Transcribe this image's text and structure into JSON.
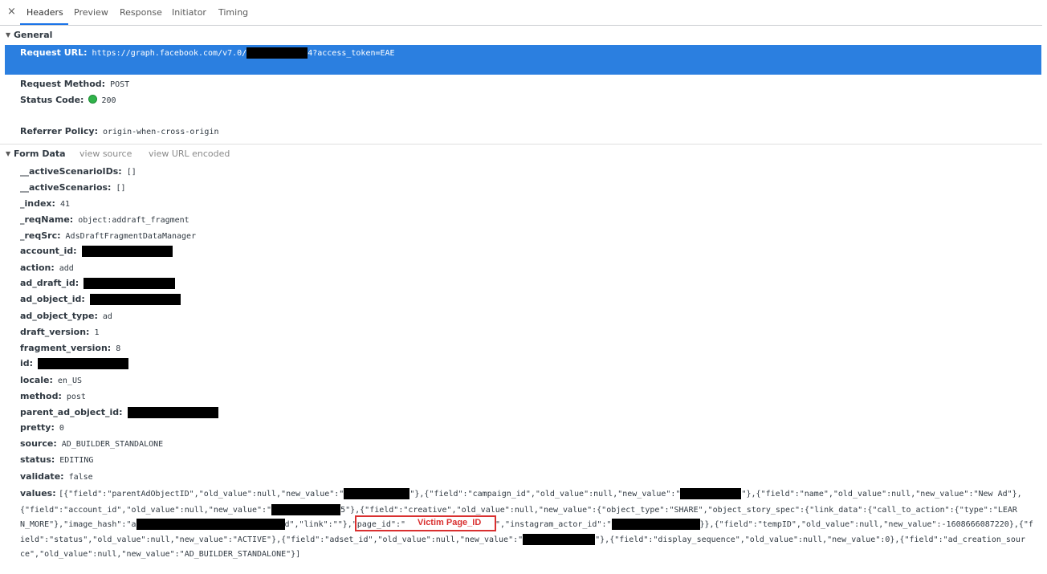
{
  "tabs": {
    "close_glyph": "×",
    "items": [
      "Headers",
      "Preview",
      "Response",
      "Initiator",
      "Timing"
    ],
    "active": "Headers"
  },
  "general": {
    "title": "General",
    "request_url_key": "Request URL:",
    "request_url_prefix": "https://graph.facebook.com/v7.0/",
    "request_url_suffix": "4?access_token=EAE",
    "request_method_key": "Request Method:",
    "request_method": "POST",
    "status_code_key": "Status Code:",
    "status_code": "200",
    "referrer_policy_key": "Referrer Policy:",
    "referrer_policy": "origin-when-cross-origin"
  },
  "form_data": {
    "title": "Form Data",
    "view_source": "view source",
    "view_url_encoded": "view URL encoded",
    "fields": [
      {
        "key": "__activeScenarioIDs:",
        "value": "[]"
      },
      {
        "key": "__activeScenarios:",
        "value": "[]"
      },
      {
        "key": "_index:",
        "value": "41"
      },
      {
        "key": "_reqName:",
        "value": "object:addraft_fragment"
      },
      {
        "key": "_reqSrc:",
        "value": "AdsDraftFragmentDataManager"
      },
      {
        "key": "account_id:",
        "value": ""
      },
      {
        "key": "action:",
        "value": "add"
      },
      {
        "key": "ad_draft_id:",
        "value": ""
      },
      {
        "key": "ad_object_id:",
        "value": ""
      },
      {
        "key": "ad_object_type:",
        "value": "ad"
      },
      {
        "key": "draft_version:",
        "value": "1"
      },
      {
        "key": "fragment_version:",
        "value": "8"
      },
      {
        "key": "id:",
        "value": ""
      },
      {
        "key": "locale:",
        "value": "en_US"
      },
      {
        "key": "method:",
        "value": "post"
      },
      {
        "key": "parent_ad_object_id:",
        "value": ""
      },
      {
        "key": "pretty:",
        "value": "0"
      },
      {
        "key": "source:",
        "value": "AD_BUILDER_STANDALONE"
      },
      {
        "key": "status:",
        "value": "EDITING"
      },
      {
        "key": "validate:",
        "value": "false"
      }
    ],
    "values_key": "values:",
    "values_l1_a": "[{\"field\":\"parentAdObjectID\",\"old_value\":null,\"new_value\":\"",
    "values_l1_b": "\"},{\"field\":\"campaign_id\",\"old_value\":null,\"new_value\":\"",
    "values_l1_c": "\"},{\"field\":\"name\",\"old_value\":null,\"new_value\":\"New Ad\"},",
    "values_l2_a": "{\"field\":\"account_id\",\"old_value\":null,\"new_value\":\"",
    "values_l2_b": "5\"},{\"field\":\"creative\",\"old_value\":null,\"new_value\":{\"object_type\":\"SHARE\",\"object_story_spec\":{\"link_data\":{\"call_to_action\":{\"type\":\"LEAR",
    "values_l3_a": "N_MORE\"},\"image_hash\":\"a",
    "values_l3_b": "d\",\"link\":\"\"},\"page_id\":\"",
    "values_l3_c": "\",\"instagram_actor_id\":\"",
    "values_l3_d": "}},{\"field\":\"tempID\",\"old_value\":null,\"new_value\":-1608666087220},{\"f",
    "values_l4_a": "ield\":\"status\",\"old_value\":null,\"new_value\":\"ACTIVE\"},{\"field\":\"adset_id\",\"old_value\":null,\"new_value\":\"",
    "values_l4_b": "\"},{\"field\":\"display_sequence\",\"old_value\":null,\"new_value\":0},{\"field\":\"ad_creation_sour",
    "values_l5": "ce\",\"old_value\":null,\"new_value\":\"AD_BUILDER_STANDALONE\"}]",
    "annotation": "Victim Page_ID"
  },
  "colors": {
    "selected_row": "#2b7fe0",
    "status_green": "#30b34a",
    "annotation_red": "#d93030",
    "redaction": "#000000"
  }
}
